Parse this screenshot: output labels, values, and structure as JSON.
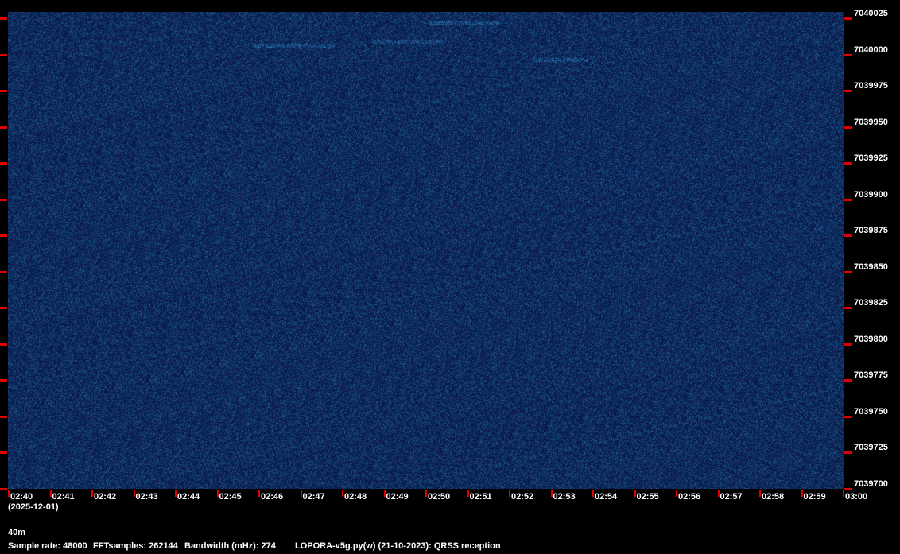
{
  "chart_data": {
    "type": "heatmap",
    "title": "LOPORA-v5g.py(w) (21-10-2023): QRSS reception",
    "colormap": {
      "low": "#081848",
      "high": "#3a90c8"
    },
    "x_ticks": [
      "02:40",
      "02:41",
      "02:42",
      "02:43",
      "02:44",
      "02:45",
      "02:46",
      "02:47",
      "02:48",
      "02:49",
      "02:50",
      "02:51",
      "02:52",
      "02:53",
      "02:54",
      "02:55",
      "02:56",
      "02:57",
      "02:58",
      "02:59",
      "03:00"
    ],
    "x_date": "(2025-12-01)",
    "y_ticks": [
      "7040025",
      "7040000",
      "7039975",
      "7039950",
      "7039925",
      "7039900",
      "7039875",
      "7039850",
      "7039825",
      "7039800",
      "7039775",
      "7039750",
      "7039725",
      "7039700"
    ],
    "ylim": [
      7039700,
      7040025
    ],
    "xlim": [
      "02:40",
      "03:00"
    ]
  },
  "info": {
    "band": "40m",
    "sample_rate": "Sample rate: 48000",
    "fft_samples": "FFTsamples: 262144",
    "bandwidth": "Bandwidth (mHz): 274",
    "program": "LOPORA-v5g.py(w) (21-10-2023): QRSS reception"
  }
}
